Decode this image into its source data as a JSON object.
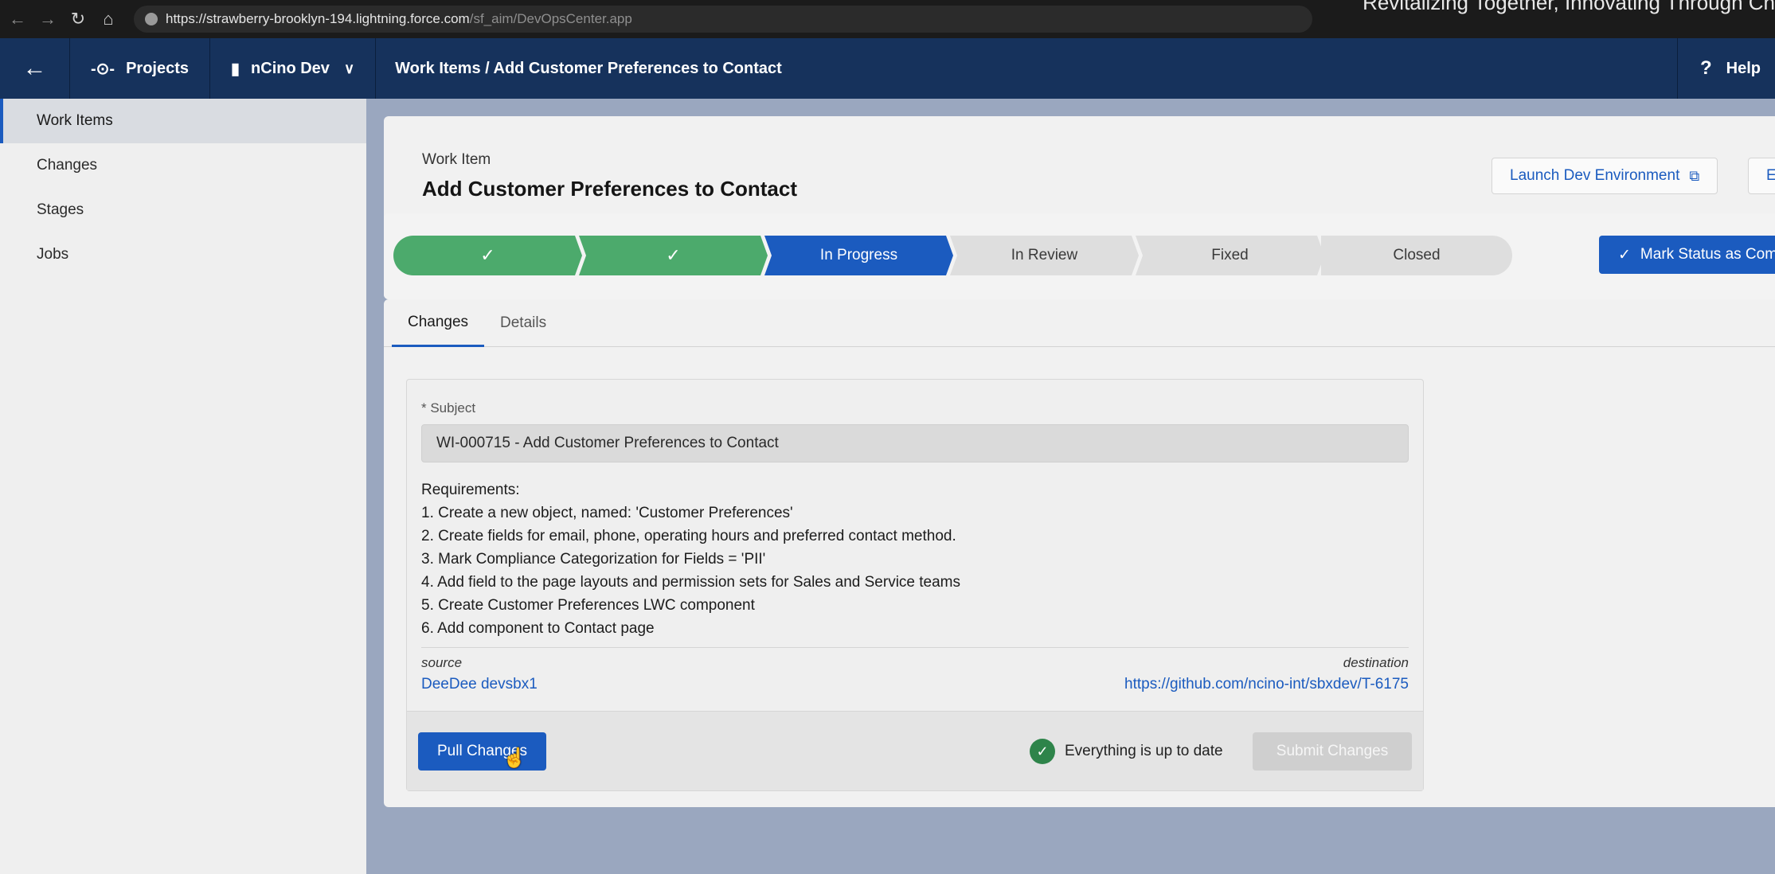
{
  "browser": {
    "url_host": "https://strawberry-brooklyn-194.lightning.force.com",
    "url_path": "/sf_aim/DevOpsCenter.app",
    "overlay_text": "Revitalizing Together, Innovating Through Ch"
  },
  "header": {
    "projects_label": "Projects",
    "project_name": "nCino Dev",
    "breadcrumb": "Work Items / Add Customer Preferences to Contact",
    "help_label": "Help"
  },
  "sidebar": {
    "items": [
      {
        "label": "Work Items"
      },
      {
        "label": "Changes"
      },
      {
        "label": "Stages"
      },
      {
        "label": "Jobs"
      }
    ]
  },
  "work_item": {
    "type_label": "Work Item",
    "title": "Add Customer Preferences to Contact",
    "launch_button": "Launch Dev Environment",
    "edit_button": "Edit"
  },
  "path": {
    "steps": [
      {
        "label": "✓",
        "state": "done"
      },
      {
        "label": "✓",
        "state": "done"
      },
      {
        "label": "In Progress",
        "state": "current"
      },
      {
        "label": "In Review",
        "state": "todo"
      },
      {
        "label": "Fixed",
        "state": "todo"
      },
      {
        "label": "Closed",
        "state": "todo"
      }
    ],
    "mark_complete": "Mark Status as Complete"
  },
  "tabs": [
    {
      "label": "Changes"
    },
    {
      "label": "Details"
    }
  ],
  "changes": {
    "subject_label": "* Subject",
    "subject_value": "WI-000715 - Add Customer Preferences to Contact",
    "requirements": [
      "Requirements:",
      "1. Create a new object, named: 'Customer Preferences'",
      "2. Create fields for email, phone, operating hours and preferred contact method.",
      "3. Mark Compliance Categorization for Fields = 'PII'",
      "4. Add field to the page layouts and permission sets for Sales and Service teams",
      "5. Create Customer Preferences LWC component",
      "6. Add component to Contact page"
    ],
    "source_label": "source",
    "source_value": "DeeDee devsbx1",
    "destination_label": "destination",
    "destination_value": "https://github.com/ncino-int/sbxdev/T-6175",
    "pull_button": "Pull Changes",
    "status_text": "Everything is up to date",
    "submit_button": "Submit Changes"
  },
  "colors": {
    "header_bg": "#16325c",
    "brand_blue": "#1b5bbf",
    "done_green": "#4caa6c",
    "ok_green": "#2e844a"
  }
}
